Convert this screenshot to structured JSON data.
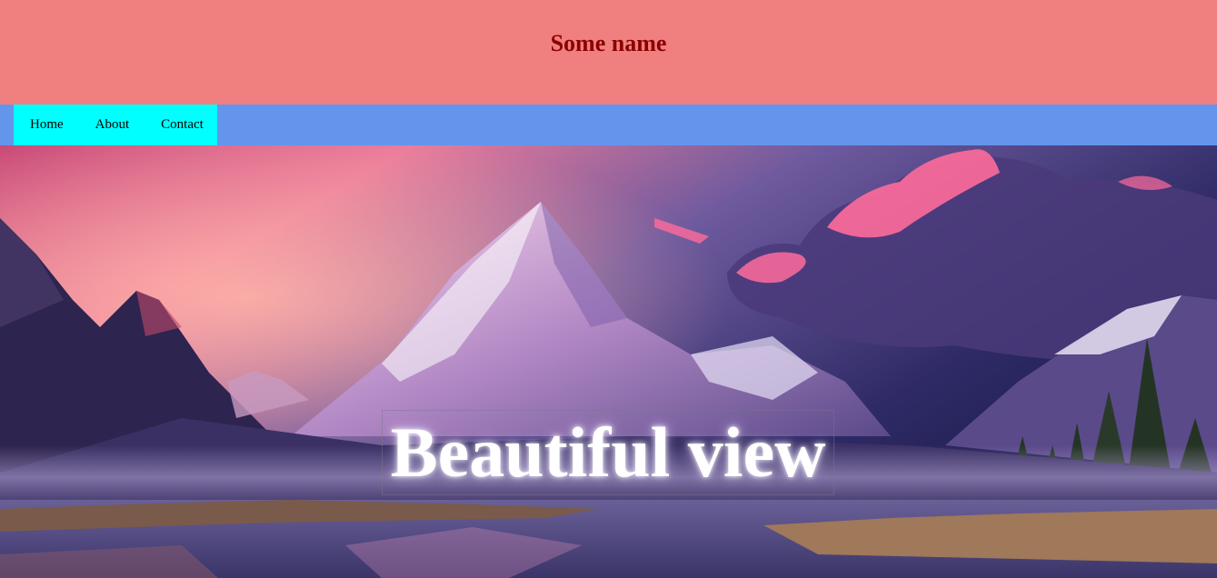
{
  "header": {
    "title": "Some name"
  },
  "nav": {
    "items": [
      {
        "label": "Home"
      },
      {
        "label": "About"
      },
      {
        "label": "Contact"
      }
    ]
  },
  "hero": {
    "caption": "Beautiful view",
    "image": "mountain-lake-sunset-landscape"
  },
  "colors": {
    "header_bg": "#f08080",
    "title_text": "#8b0000",
    "navbar_bg": "#6495ed",
    "nav_list_bg": "#00ffff"
  }
}
